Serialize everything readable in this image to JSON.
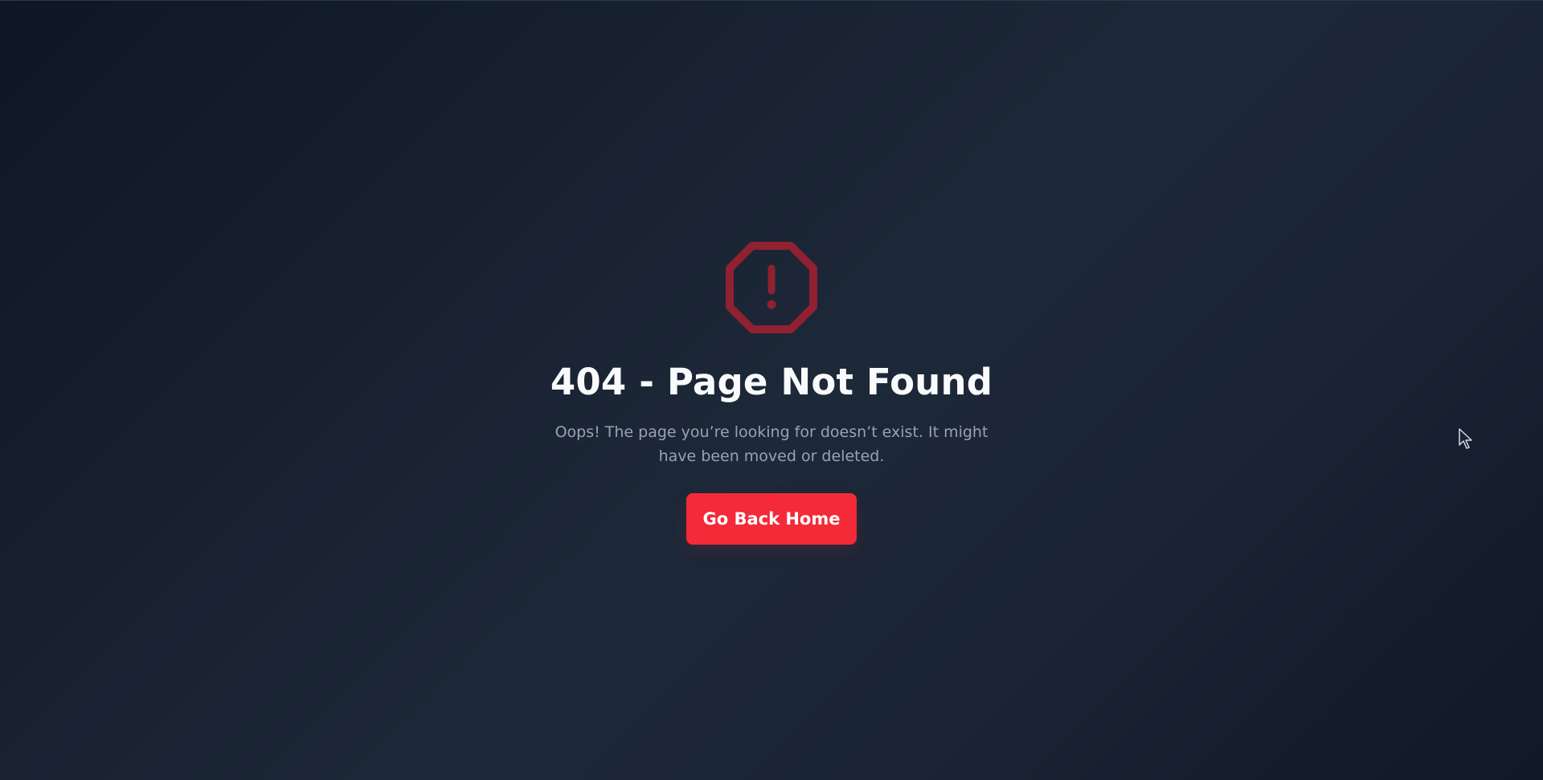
{
  "page": {
    "title": "404 - Page Not Found",
    "message": "Oops! The page you’re looking for doesn’t exist. It might have been moved or deleted."
  },
  "actions": {
    "home_button": "Go Back Home"
  },
  "icons": {
    "alert": "octagon-alert-icon",
    "cursor": "mouse-cursor-icon"
  },
  "colors": {
    "accent": "#f42a38",
    "icon": "#8f2130",
    "title": "#f8fafc",
    "text_muted": "#98a2b3",
    "background_dark": "#111827"
  }
}
